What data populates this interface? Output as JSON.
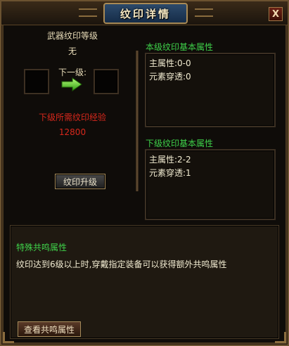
{
  "window": {
    "title": "纹印详情",
    "close_label": "X"
  },
  "left": {
    "weapon_label": "武器纹印等级",
    "weapon_value": "无",
    "next_label": "下一级:",
    "need_label": "下级所需纹印经验",
    "need_value": "12800",
    "upgrade_button": "纹印升级"
  },
  "current_attrs": {
    "title": "本级纹印基本属性",
    "lines": [
      "主属性:0-0",
      "元素穿透:0"
    ]
  },
  "next_attrs": {
    "title": "下级纹印基本属性",
    "lines": [
      "主属性:2-2",
      "元素穿透:1"
    ]
  },
  "resonance": {
    "title": "特殊共鸣属性",
    "description": "纹印达到6级以上时,穿戴指定装备可以获得额外共鸣属性",
    "view_button": "查看共鸣属性"
  },
  "colors": {
    "accent_green": "#3fd24a",
    "warning_red": "#d8281c",
    "text_light": "#f2ecd2",
    "frame_gold": "#8a6c3e"
  },
  "icons": {
    "arrow": "right-arrow-icon",
    "close": "close-icon"
  }
}
